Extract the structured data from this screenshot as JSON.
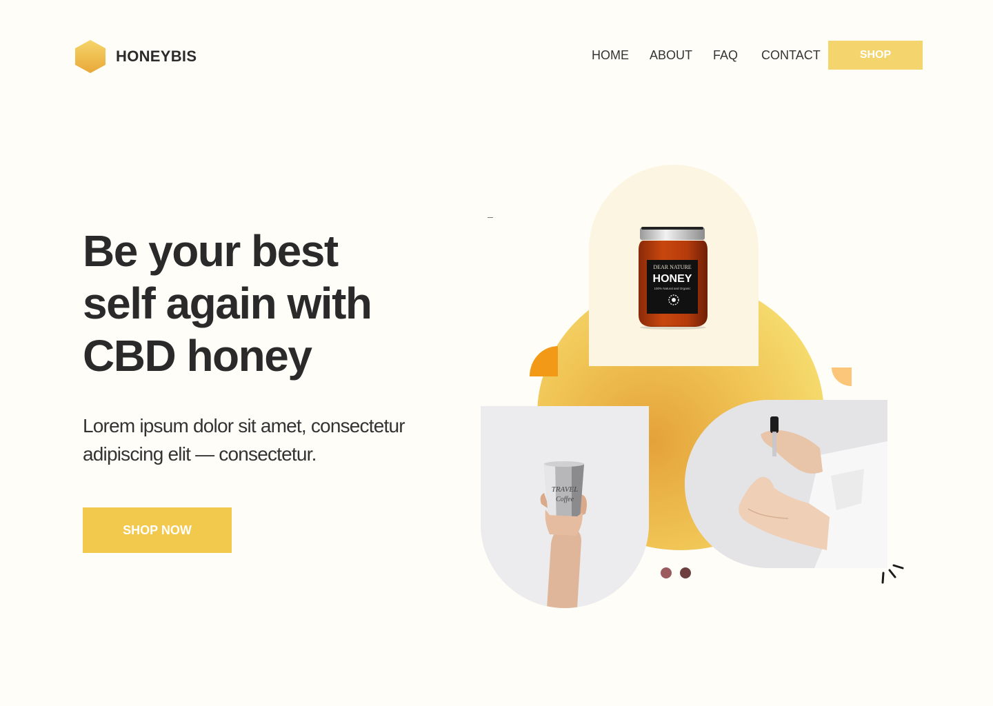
{
  "brand": {
    "name": "HONEYBIS",
    "logo_color": "#f2c94c"
  },
  "nav": {
    "items": [
      "HOME",
      "ABOUT",
      "FAQ",
      "CONTACT"
    ],
    "shop_label": "SHOP"
  },
  "hero": {
    "headline_lines": [
      "Be your best",
      "self again with",
      "CBD honey"
    ],
    "subtext_lines": [
      "Lorem ipsum dolor sit amet, consectetur",
      "adipiscing elit — consectetur."
    ],
    "cta_label": "SHOP NOW"
  },
  "jar": {
    "brand": "DEAR NATURE",
    "name": "HONEY",
    "tagline": "100% Natural and Organic"
  },
  "cup": {
    "print_line1": "TRAVEL",
    "print_line2": "Coffee"
  },
  "carousel": {
    "dot_count": 2,
    "dot_colors": [
      "#9a5a5e",
      "#6e3f40"
    ]
  },
  "colors": {
    "accent": "#f2c94c",
    "shop_button": "#f3d46d",
    "background": "#fffdf8",
    "text": "#2b2b2b"
  }
}
